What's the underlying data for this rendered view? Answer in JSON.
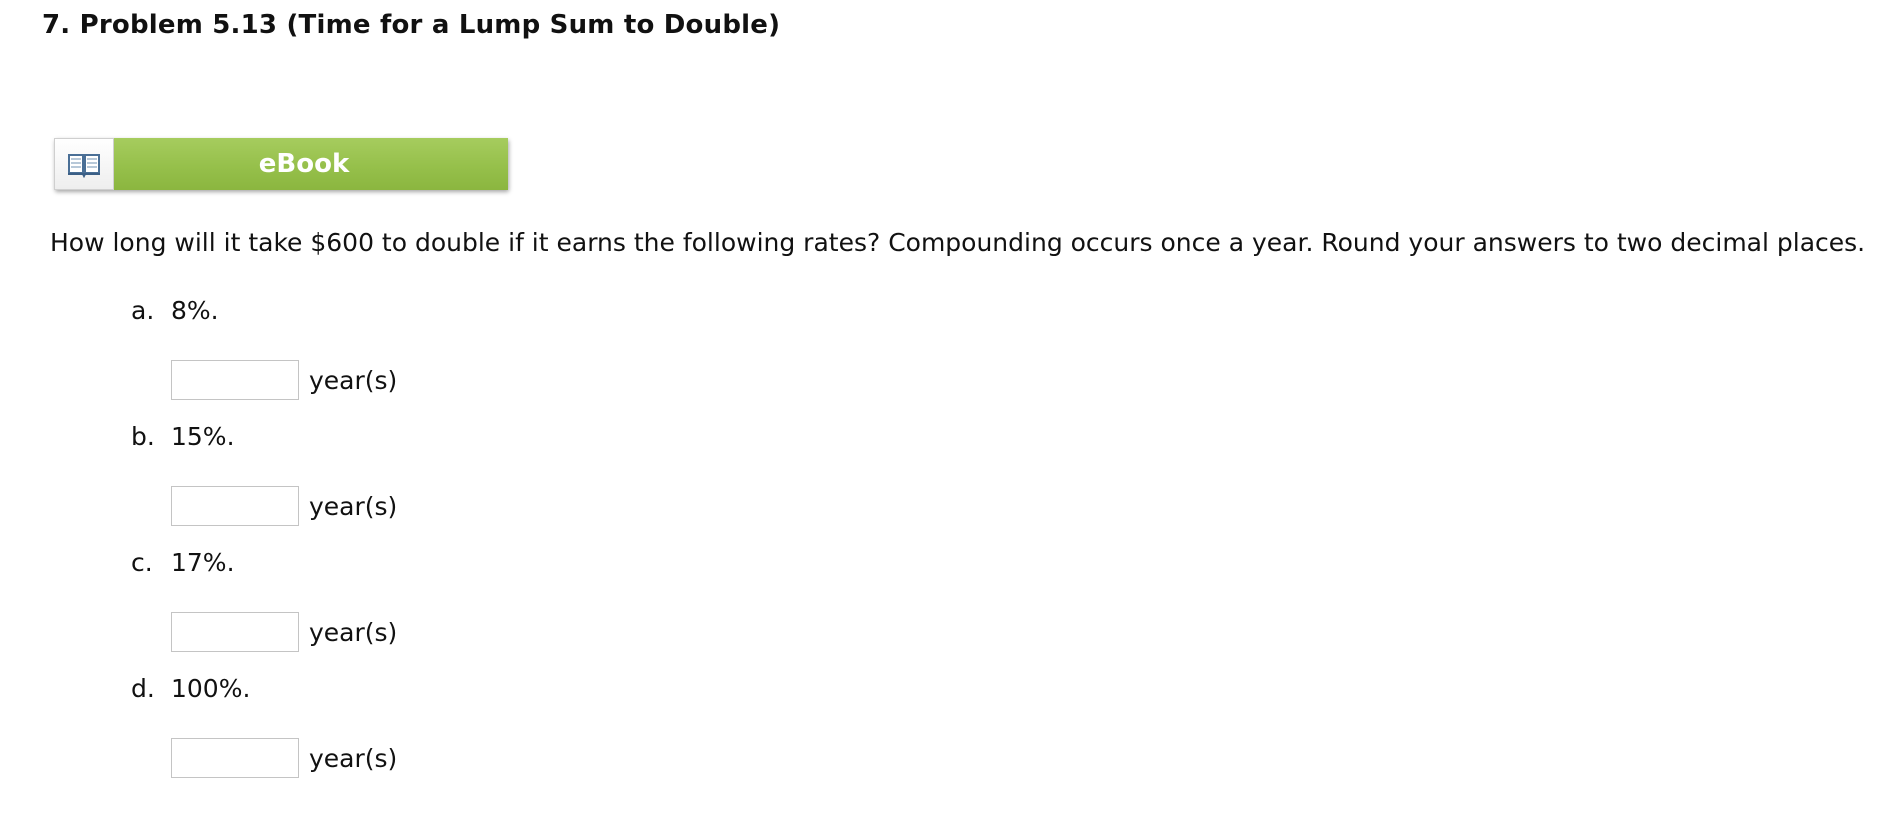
{
  "problem": {
    "title": "7.  Problem 5.13 (Time for a Lump Sum to Double)"
  },
  "ebook": {
    "label": "eBook",
    "icon": "book-icon"
  },
  "question": {
    "text": "How long will it take $600 to double if it earns the following rates? Compounding occurs once a year. Round your answers to two decimal places."
  },
  "parts": [
    {
      "letter": "a.",
      "rate": "8%.",
      "answer": "",
      "unit": "year(s)"
    },
    {
      "letter": "b.",
      "rate": "15%.",
      "answer": "",
      "unit": "year(s)"
    },
    {
      "letter": "c.",
      "rate": "17%.",
      "answer": "",
      "unit": "year(s)"
    },
    {
      "letter": "d.",
      "rate": "100%.",
      "answer": "",
      "unit": "year(s)"
    }
  ],
  "colors": {
    "ebook_green": "#96c04b",
    "input_border": "#c4c4c4"
  }
}
